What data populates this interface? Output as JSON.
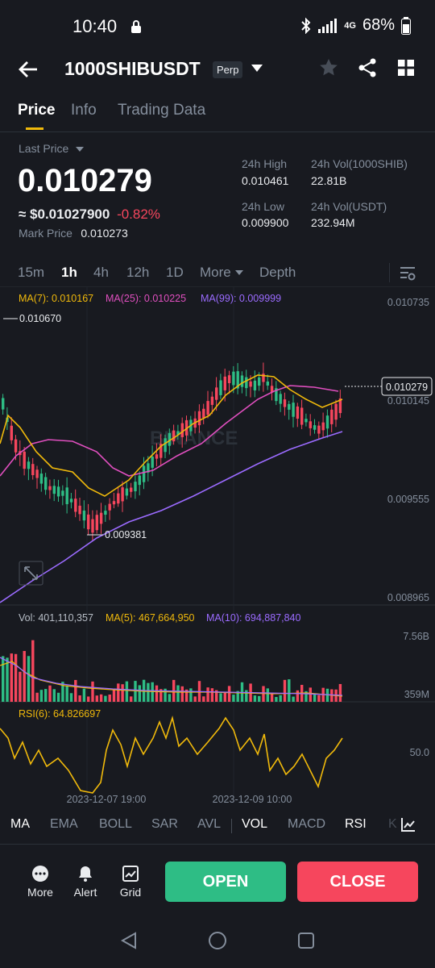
{
  "status_bar": {
    "time": "10:40",
    "network": "4G",
    "battery": "68%"
  },
  "header": {
    "symbol": "1000SHIBUSDT",
    "contract_badge": "Perp"
  },
  "tabs": [
    "Price",
    "Info",
    "Trading Data"
  ],
  "price": {
    "last_price_label": "Last Price",
    "last_price": "0.010279",
    "usd_price": "≈ $0.01027900",
    "change": "-0.82%",
    "mark_label": "Mark Price",
    "mark_price": "0.010273"
  },
  "stats": {
    "high_label": "24h High",
    "high": "0.010461",
    "vol_base_label": "24h Vol(1000SHIB)",
    "vol_base": "22.81B",
    "low_label": "24h Low",
    "low": "0.009900",
    "vol_quote_label": "24h Vol(USDT)",
    "vol_quote": "232.94M"
  },
  "timeframes": [
    "15m",
    "1h",
    "4h",
    "12h",
    "1D",
    "More",
    "Depth"
  ],
  "ma_legend": {
    "ma7": "MA(7): 0.010167",
    "ma25": "MA(25): 0.010225",
    "ma99": "MA(99): 0.009999"
  },
  "price_axis": [
    "0.010735",
    "0.010145",
    "0.009555",
    "0.008965"
  ],
  "annotations": {
    "high": "0.010670",
    "low": "0.009381",
    "current": "0.010279"
  },
  "watermark": "BINANCE",
  "volume": {
    "vol": "Vol: 401,110,357",
    "ma5": "MA(5): 467,664,950",
    "ma10": "MA(10): 694,887,840",
    "axis_top": "7.56B",
    "axis_bottom": "359M"
  },
  "rsi": {
    "label": "RSI(6): 64.826697",
    "axis": "50.0"
  },
  "time_axis": [
    "2023-12-07 19:00",
    "2023-12-09 10:00"
  ],
  "indicators": [
    "MA",
    "EMA",
    "BOLL",
    "SAR",
    "AVL",
    "VOL",
    "MACD",
    "RSI",
    "K"
  ],
  "bottom": {
    "more": "More",
    "alert": "Alert",
    "grid": "Grid",
    "open": "OPEN",
    "close": "CLOSE"
  },
  "colors": {
    "up": "#2ebd85",
    "down": "#f6465d",
    "ma7": "#f0b90b",
    "ma25": "#e04fbf",
    "ma99": "#9b6bff",
    "accent": "#f0b90b"
  },
  "chart_data": {
    "type": "candlestick",
    "price_range": [
      0.008965,
      0.010735
    ],
    "candles": []
  }
}
